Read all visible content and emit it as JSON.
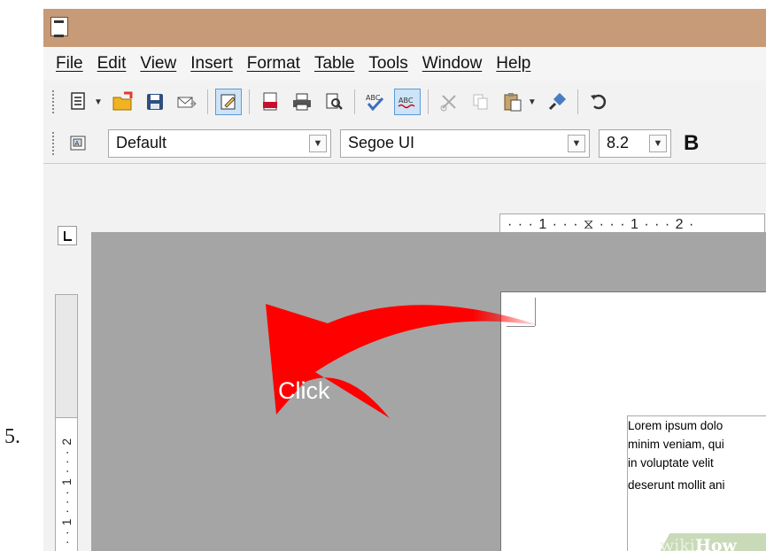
{
  "step_number": "5.",
  "menu": [
    "File",
    "Edit",
    "View",
    "Insert",
    "Format",
    "Table",
    "Tools",
    "Window",
    "Help"
  ],
  "toolbar": {
    "buttons": [
      "new-document-icon",
      "open-folder-icon",
      "save-icon",
      "email-icon",
      "edit-mode-icon",
      "export-pdf-icon",
      "print-icon",
      "print-preview-icon",
      "spellcheck-icon",
      "autospellcheck-icon",
      "cut-icon",
      "copy-icon",
      "paste-icon",
      "clone-formatting-icon",
      "undo-icon"
    ]
  },
  "format_bar": {
    "style_value": "Default",
    "font_value": "Segoe UI",
    "size_value": "8.2",
    "bold_label": "B"
  },
  "ruler": {
    "horizontal_text": "· · · 1 · · · ⧖ · · · 1 · · · 2 ·",
    "vertical_text": "· · · 1 · · · 1 · · · 2"
  },
  "document": {
    "lines": [
      "Lorem ipsum dolo",
      "minim veniam, qui",
      "in voluptate velit",
      "deserunt mollit ani"
    ]
  },
  "annotation": {
    "label": "Click",
    "color": "#ff0000"
  },
  "watermark": {
    "wiki": "wiki",
    "how": "How"
  },
  "colors": {
    "titlebar": "#c79a78",
    "canvas": "#a5a5a5"
  }
}
